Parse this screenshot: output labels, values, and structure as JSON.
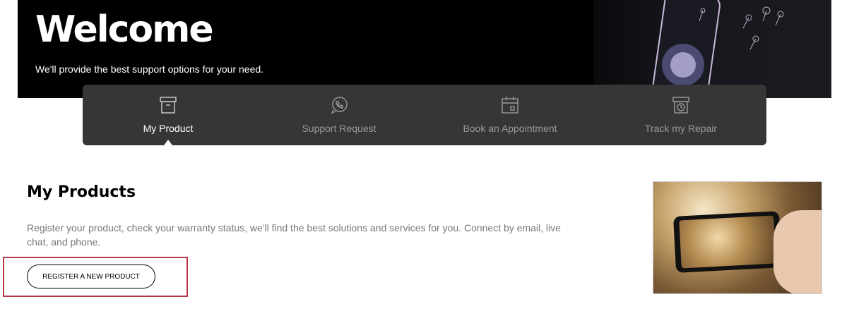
{
  "hero": {
    "title": "Welcome",
    "subtitle": "We'll provide the best support options for your need."
  },
  "tabs": [
    {
      "label": "My Product",
      "icon": "box-icon",
      "active": true
    },
    {
      "label": "Support Request",
      "icon": "phone-chat-icon",
      "active": false
    },
    {
      "label": "Book an Appointment",
      "icon": "calendar-icon",
      "active": false
    },
    {
      "label": "Track my Repair",
      "icon": "box-clock-icon",
      "active": false
    }
  ],
  "section": {
    "title": "My Products",
    "description": "Register your product, check your warranty status, we'll find the best solutions and services for you. Connect by email, live chat, and phone.",
    "register_button": "REGISTER A NEW PRODUCT"
  },
  "colors": {
    "tab_bar": "#363636",
    "highlight": "#b73a47"
  }
}
